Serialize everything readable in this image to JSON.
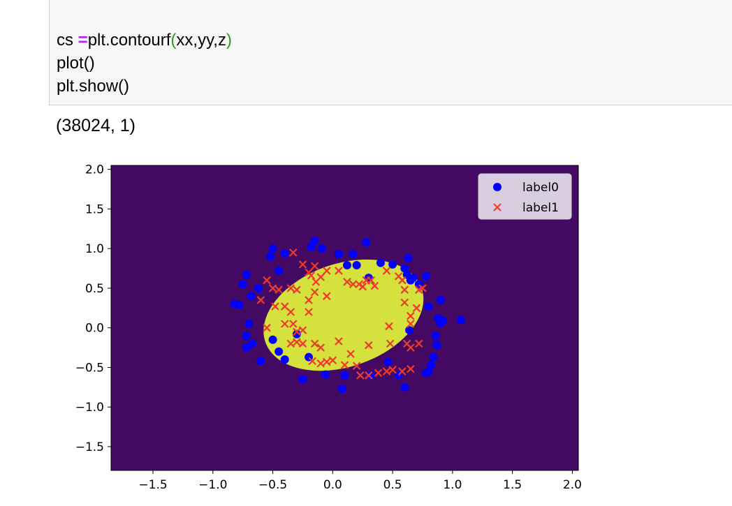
{
  "code": {
    "line1": {
      "pre": "cs ",
      "op": "=",
      "mid": "plt.contourf",
      "open": "(",
      "args": "xx,yy,z",
      "close": ")"
    },
    "line2": "plot()",
    "line3": "plt.show()"
  },
  "output_text": "(38024, 1)",
  "chart_data": {
    "type": "scatter",
    "xlim": [
      -1.85,
      2.05
    ],
    "ylim": [
      -1.8,
      2.05
    ],
    "xticks": [
      -1.5,
      -1.0,
      -0.5,
      0.0,
      0.5,
      1.0,
      1.5,
      2.0
    ],
    "xtick_labels": [
      "−1.5",
      "−1.0",
      "−0.5",
      "0.0",
      "0.5",
      "1.0",
      "1.5",
      "2.0"
    ],
    "yticks": [
      2.0,
      1.5,
      1.0,
      0.5,
      0.0,
      -0.5,
      -1.0,
      -1.5
    ],
    "ytick_labels": [
      "2.0",
      "1.5",
      "1.0",
      "0.5",
      "0.0",
      "−0.5",
      "−1.0",
      "−1.5"
    ],
    "background_color": "#440a63",
    "region_color": "#d5e13c",
    "region": {
      "cx": 0.09,
      "cy": 0.16,
      "rx": 0.69,
      "ry": 0.65,
      "angle": -19
    },
    "legend_placement": "top-right",
    "series": [
      {
        "name": "label0",
        "marker": "circle",
        "color": "#0000ff",
        "points": [
          [
            -0.5,
            1.0
          ],
          [
            -0.52,
            0.9
          ],
          [
            -0.4,
            0.94
          ],
          [
            -0.15,
            1.1
          ],
          [
            -0.18,
            1.02
          ],
          [
            -0.09,
            1.0
          ],
          [
            0.05,
            0.93
          ],
          [
            0.17,
            0.93
          ],
          [
            0.28,
            1.08
          ],
          [
            0.4,
            0.82
          ],
          [
            0.5,
            0.8
          ],
          [
            0.63,
            0.88
          ],
          [
            0.6,
            0.75
          ],
          [
            0.62,
            0.67
          ],
          [
            0.67,
            0.63
          ],
          [
            0.78,
            0.65
          ],
          [
            0.65,
            0.6
          ],
          [
            0.9,
            0.35
          ],
          [
            0.8,
            0.27
          ],
          [
            0.88,
            0.12
          ],
          [
            0.9,
            0.06
          ],
          [
            0.92,
            0.09
          ],
          [
            1.07,
            0.1
          ],
          [
            0.86,
            -0.1
          ],
          [
            0.87,
            -0.22
          ],
          [
            0.84,
            -0.37
          ],
          [
            0.82,
            -0.47
          ],
          [
            0.8,
            -0.55
          ],
          [
            0.78,
            -0.57
          ],
          [
            0.6,
            -0.75
          ],
          [
            0.46,
            -0.43
          ],
          [
            0.55,
            -0.6
          ],
          [
            0.32,
            -0.6
          ],
          [
            0.1,
            -0.6
          ],
          [
            0.08,
            -0.77
          ],
          [
            -0.06,
            -0.59
          ],
          [
            -0.25,
            -0.65
          ],
          [
            -0.45,
            -0.3
          ],
          [
            -0.4,
            -0.4
          ],
          [
            -0.5,
            -0.15
          ],
          [
            -0.6,
            -0.42
          ],
          [
            -0.67,
            -0.2
          ],
          [
            -0.72,
            -0.25
          ],
          [
            -0.7,
            0.05
          ],
          [
            -0.72,
            -0.1
          ],
          [
            -0.75,
            0.55
          ],
          [
            -0.72,
            0.67
          ],
          [
            -0.62,
            0.5
          ],
          [
            -0.68,
            0.4
          ],
          [
            -0.78,
            0.29
          ],
          [
            -0.82,
            0.3
          ],
          [
            -0.45,
            0.72
          ],
          [
            0.12,
            0.79
          ],
          [
            0.2,
            0.79
          ],
          [
            0.3,
            0.63
          ],
          [
            -0.3,
            -0.08
          ],
          [
            0.64,
            -0.03
          ],
          [
            -0.2,
            -0.37
          ],
          [
            0.72,
            0.55
          ]
        ]
      },
      {
        "name": "label1",
        "marker": "x",
        "color": "#ee3a2a",
        "points": [
          [
            -0.33,
            0.95
          ],
          [
            -0.25,
            0.8
          ],
          [
            -0.15,
            0.78
          ],
          [
            -0.2,
            0.7
          ],
          [
            -0.18,
            0.66
          ],
          [
            -0.14,
            0.58
          ],
          [
            -0.1,
            0.64
          ],
          [
            -0.05,
            0.72
          ],
          [
            0.05,
            0.72
          ],
          [
            0.12,
            0.58
          ],
          [
            0.17,
            0.55
          ],
          [
            0.22,
            0.55
          ],
          [
            0.28,
            0.6
          ],
          [
            0.45,
            0.72
          ],
          [
            0.55,
            0.65
          ],
          [
            -0.55,
            0.6
          ],
          [
            -0.5,
            0.5
          ],
          [
            -0.45,
            0.48
          ],
          [
            -0.35,
            0.5
          ],
          [
            -0.3,
            0.48
          ],
          [
            -0.6,
            0.35
          ],
          [
            -0.48,
            0.27
          ],
          [
            -0.4,
            0.27
          ],
          [
            -0.35,
            0.2
          ],
          [
            -0.2,
            0.35
          ],
          [
            -0.2,
            0.2
          ],
          [
            -0.15,
            0.45
          ],
          [
            -0.05,
            0.4
          ],
          [
            -0.4,
            0.05
          ],
          [
            -0.33,
            0.05
          ],
          [
            -0.3,
            -0.05
          ],
          [
            -0.25,
            -0.03
          ],
          [
            -0.55,
            0.0
          ],
          [
            -0.35,
            -0.2
          ],
          [
            -0.3,
            -0.18
          ],
          [
            -0.25,
            -0.2
          ],
          [
            -0.15,
            -0.2
          ],
          [
            -0.1,
            -0.25
          ],
          [
            0.05,
            -0.17
          ],
          [
            -0.17,
            -0.42
          ],
          [
            -0.1,
            -0.45
          ],
          [
            -0.05,
            -0.43
          ],
          [
            0.0,
            -0.41
          ],
          [
            0.1,
            -0.47
          ],
          [
            0.2,
            -0.48
          ],
          [
            0.23,
            -0.6
          ],
          [
            0.3,
            -0.6
          ],
          [
            0.3,
            -0.22
          ],
          [
            0.38,
            -0.57
          ],
          [
            0.45,
            -0.55
          ],
          [
            0.5,
            -0.53
          ],
          [
            0.58,
            -0.55
          ],
          [
            0.65,
            -0.52
          ],
          [
            0.72,
            -0.2
          ],
          [
            0.65,
            -0.25
          ],
          [
            0.62,
            -0.2
          ],
          [
            0.48,
            -0.2
          ],
          [
            0.47,
            0.02
          ],
          [
            0.65,
            0.15
          ],
          [
            0.7,
            0.25
          ],
          [
            0.6,
            0.32
          ],
          [
            0.6,
            0.48
          ],
          [
            0.72,
            0.48
          ],
          [
            0.35,
            0.53
          ],
          [
            0.25,
            0.52
          ],
          [
            0.32,
            0.6
          ],
          [
            0.58,
            0.6
          ],
          [
            0.65,
            0.05
          ],
          [
            0.75,
            0.5
          ],
          [
            0.15,
            -0.33
          ]
        ]
      }
    ]
  }
}
